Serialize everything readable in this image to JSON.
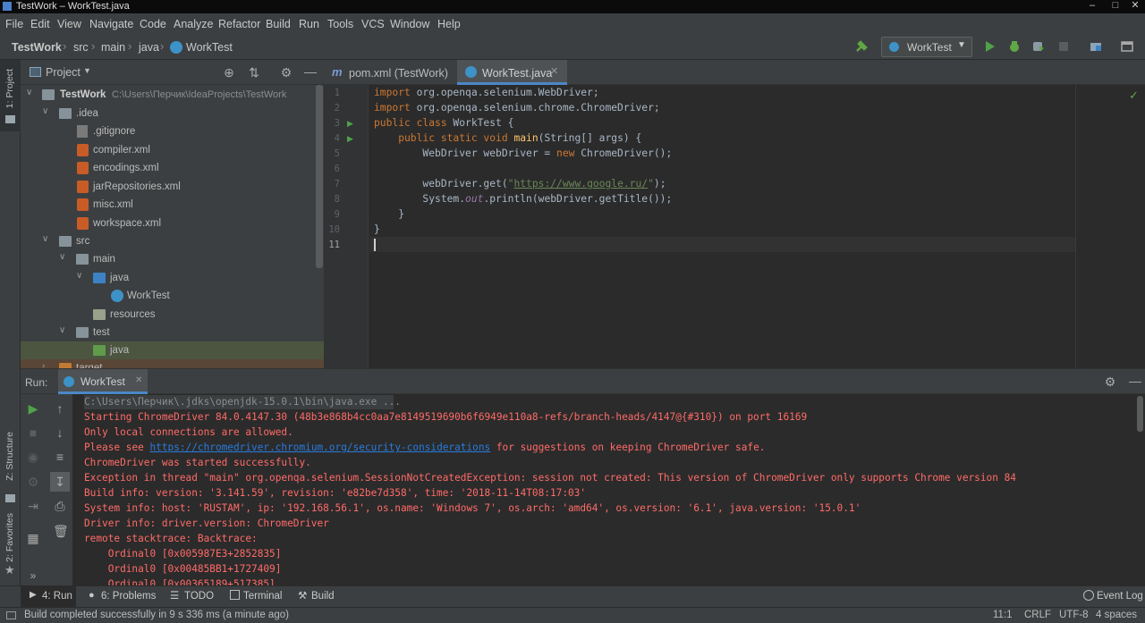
{
  "window": {
    "title": "TestWork – WorkTest.java"
  },
  "menu": [
    "File",
    "Edit",
    "View",
    "Navigate",
    "Code",
    "Analyze",
    "Refactor",
    "Build",
    "Run",
    "Tools",
    "VCS",
    "Window",
    "Help"
  ],
  "breadcrumb": [
    "TestWork",
    "src",
    "main",
    "java",
    "WorkTest"
  ],
  "run_config": "WorkTest",
  "project_panel": {
    "title": "Project",
    "root_name": "TestWork",
    "root_path": "C:\\Users\\Перчик\\IdeaProjects\\TestWork"
  },
  "tree": [
    {
      "label": "TestWork"
    },
    {
      "label": ".idea"
    },
    {
      "label": ".gitignore"
    },
    {
      "label": "compiler.xml"
    },
    {
      "label": "encodings.xml"
    },
    {
      "label": "jarRepositories.xml"
    },
    {
      "label": "misc.xml"
    },
    {
      "label": "workspace.xml"
    },
    {
      "label": "src"
    },
    {
      "label": "main"
    },
    {
      "label": "java"
    },
    {
      "label": "WorkTest"
    },
    {
      "label": "resources"
    },
    {
      "label": "test"
    },
    {
      "label": "java"
    },
    {
      "label": "target"
    }
  ],
  "left_strip": {
    "project": "1: Project",
    "structure": "Z: Structure",
    "favorites": "2: Favorites"
  },
  "editor_tabs": [
    "pom.xml (TestWork)",
    "WorkTest.java"
  ],
  "line_numbers": [
    "1",
    "2",
    "3",
    "4",
    "5",
    "6",
    "7",
    "8",
    "9",
    "10",
    "11"
  ],
  "code": {
    "l1_kw": "import",
    "l1_rest": " org.openqa.selenium.WebDriver;",
    "l2_kw": "import",
    "l2_rest": " org.openqa.selenium.chrome.ChromeDriver;",
    "l3_kw1": "public class",
    "l3_rest": " WorkTest {",
    "l4_kw": "    public static void ",
    "l4_fn": "main",
    "l4_rest": "(String[] args) {",
    "l5_a": "        WebDriver webDriver = ",
    "l5_kw": "new",
    "l5_b": " ChromeDriver();",
    "l7_a": "        webDriver.get(",
    "l7_q1": "\"",
    "l7_url": "https://www.google.ru/",
    "l7_q2": "\"",
    "l7_b": ");",
    "l8_a": "        System.",
    "l8_it": "out",
    "l8_b": ".println(webDriver.getTitle());",
    "l9": "    }",
    "l10": "}"
  },
  "run_panel": {
    "label": "Run:",
    "tab": "WorkTest"
  },
  "console": {
    "cmd": "C:\\Users\\Перчик\\.jdks\\openjdk-15.0.1\\bin\\java.exe ...",
    "l1": "Starting ChromeDriver 84.0.4147.30 (48b3e868b4cc0aa7e8149519690b6f6949e110a8-refs/branch-heads/4147@{#310}) on port 16169",
    "l2": "Only local connections are allowed.",
    "l3a": "Please see ",
    "l3_link": "https://chromedriver.chromium.org/security-considerations",
    "l3b": " for suggestions on keeping ChromeDriver safe.",
    "l4": "ChromeDriver was started successfully.",
    "l5": "Exception in thread \"main\" org.openqa.selenium.SessionNotCreatedException: session not created: This version of ChromeDriver only supports Chrome version 84",
    "l6": "Build info: version: '3.141.59', revision: 'e82be7d358', time: '2018-11-14T08:17:03'",
    "l7": "System info: host: 'RUSTAM', ip: '192.168.56.1', os.name: 'Windows 7', os.arch: 'amd64', os.version: '6.1', java.version: '15.0.1'",
    "l8": "Driver info: driver.version: ChromeDriver",
    "l9": "remote stacktrace: Backtrace:",
    "l10": "    Ordinal0 [0x005987E3+2852835]",
    "l11": "    Ordinal0 [0x00485BB1+1727409]",
    "l12": "    Ordinal0 [0x00365189+517385]"
  },
  "bottom_tabs": {
    "run": "4: Run",
    "problems": "6: Problems",
    "todo": "TODO",
    "terminal": "Terminal",
    "build": "Build",
    "eventlog": "Event Log"
  },
  "status": {
    "message": "Build completed successfully in 9 s 336 ms (a minute ago)",
    "position": "11:1",
    "line_sep": "CRLF",
    "encoding": "UTF-8",
    "indent": "4 spaces"
  }
}
